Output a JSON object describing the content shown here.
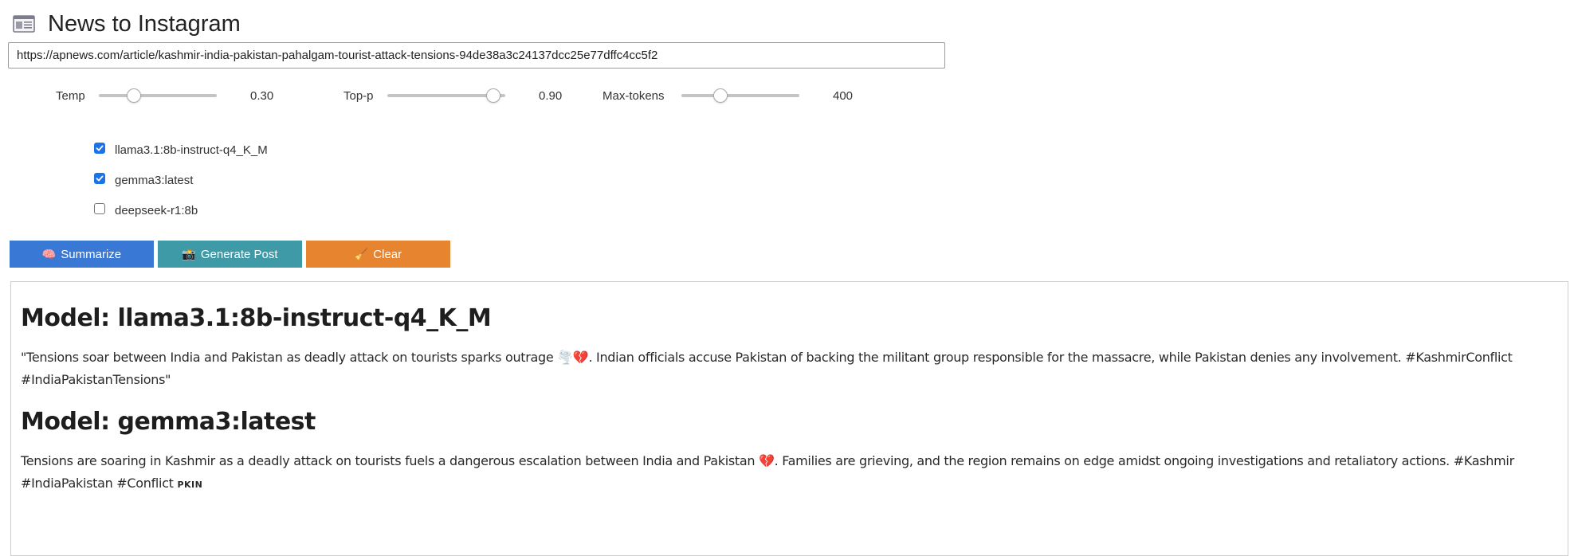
{
  "app": {
    "title": "News to Instagram",
    "icon": "newspaper-icon"
  },
  "url_input": {
    "value": "https://apnews.com/article/kashmir-india-pakistan-pahalgam-tourist-attack-tensions-94de38a3c24137dcc25e77dffc4cc5f2",
    "placeholder": ""
  },
  "sliders": [
    {
      "label": "Temp",
      "value": "0.30",
      "fraction": 0.3
    },
    {
      "label": "Top-p",
      "value": "0.90",
      "fraction": 0.9
    },
    {
      "label": "Max-tokens",
      "value": "400",
      "fraction": 0.33
    }
  ],
  "models": [
    {
      "label": "llama3.1:8b-instruct-q4_K_M",
      "checked": true
    },
    {
      "label": "gemma3:latest",
      "checked": true
    },
    {
      "label": "deepseek-r1:8b",
      "checked": false
    }
  ],
  "buttons": {
    "summarize": {
      "label": "Summarize",
      "emoji": "🧠",
      "color": "#3a78d6"
    },
    "generate": {
      "label": "Generate Post",
      "emoji": "📸",
      "color": "#3d9aa6"
    },
    "clear": {
      "label": "Clear",
      "emoji": "🧹",
      "color": "#e6842f"
    }
  },
  "results": [
    {
      "heading": "Model: llama3.1:8b-instruct-q4_K_M",
      "text_line1": "\"Tensions soar between India and Pakistan as deadly attack on tourists sparks outrage 🌪️💔. Indian officials accuse Pakistan of backing the militant group responsible for the massacre, while Pakistan denies any involvement. #KashmirConflict",
      "text_line2": "#IndiaPakistanTensions\""
    },
    {
      "heading": "Model: gemma3:latest",
      "text_line1": "Tensions are soaring in Kashmir as a deadly attack on tourists fuels a dangerous escalation between India and Pakistan 💔. Families are grieving, and the region remains on edge amidst ongoing investigations and retaliatory actions. #Kashmir",
      "text_line2": "#IndiaPakistan #Conflict",
      "tag": "PKIN"
    }
  ]
}
